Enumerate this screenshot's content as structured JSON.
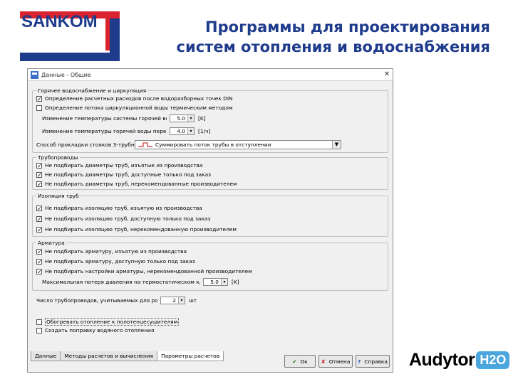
{
  "logo": {
    "text": "SANKOM"
  },
  "slide": {
    "title_line1": "Программы для проектирования",
    "title_line2": "систем отопления и водоснабжения"
  },
  "window": {
    "title": "Данные - Общие",
    "group_hot_water": {
      "legend": "Горячее водоснабжение и циркуляция",
      "cb1": "Определение расчетных расходов после водоразборных точек DIN",
      "cb2": "Определение потока циркуляционной воды термическим методом",
      "spin1_label": "Изменение температуры системы горячей воды",
      "spin1_value": "5.0",
      "spin1_unit": "[K]",
      "spin2_label": "Изменение температуры горячей воды перед п",
      "spin2_value": "4.0",
      "spin2_unit": "[1/ч]",
      "select_label": "Способ прокладки стояков 3-трубн",
      "select_value": "Суммировать поток трубы в отступлении"
    },
    "group_pipes": {
      "legend": "Трубопроводы",
      "cb1": "Не подбирать диаметры труб, изъятые из производства",
      "cb2": "Не подбирать диаметры труб, доступные только под заказ",
      "cb3": "Не подбирать диаметры труб, нерекомендованные производителем"
    },
    "group_insulation": {
      "legend": "Изоляция труб",
      "cb1": "Не подбирать изоляцию труб, изъятую из производства",
      "cb2": "Не подбирать изоляцию труб, доступную только под заказ",
      "cb3": "Не подбирать изоляцию труб, нерекомендованную производителем"
    },
    "group_fittings": {
      "legend": "Арматура",
      "cb1": "Не подбирать арматуру, изъятую из производства",
      "cb2": "Не подбирать арматуру, доступную только под заказ",
      "cb3": "Не подбирать настройки арматуры, нерекомендованной производителем",
      "spin_label": "Максимальная потеря давления на термостатическом клапане",
      "spin_value": "5.0",
      "spin_unit": "[K]"
    },
    "riser_label": "Число трубопроводов, учитываемых для розеток",
    "riser_value": "2",
    "riser_unit": "шт",
    "extra_cb1": "Обогревать отопление к полотенцесушителям",
    "extra_cb2": "Создать поправку водяного отопления",
    "tabs": [
      "Данные",
      "Методы расчетов и вычисления",
      "Параметры расчетов"
    ],
    "buttons": {
      "ok": "Ок",
      "cancel": "Отмена",
      "help": "Справка"
    }
  },
  "brand": {
    "word": "Audytor",
    "badge": "H2O"
  }
}
